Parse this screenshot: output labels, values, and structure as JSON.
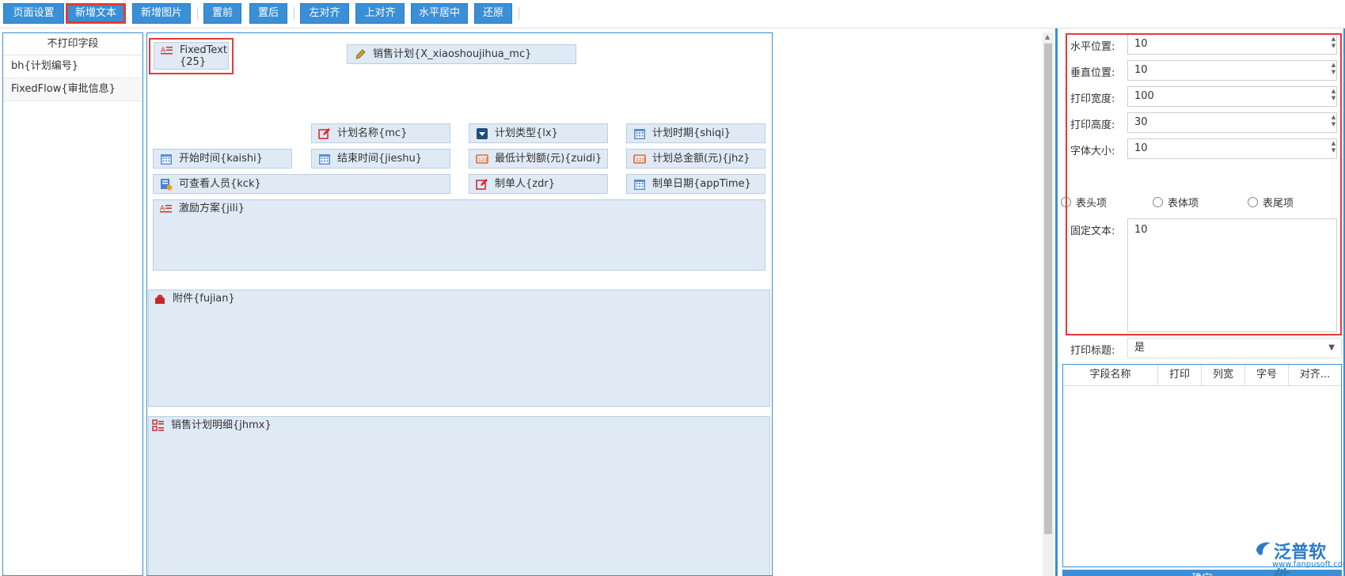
{
  "toolbar": {
    "buttons": [
      "页面设置",
      "新增文本",
      "新增图片",
      "置前",
      "置后",
      "左对齐",
      "上对齐",
      "水平居中",
      "还原"
    ]
  },
  "left_panel": {
    "title": "不打印字段",
    "items": [
      "bh{计划编号}",
      "FixedFlow{审批信息}"
    ]
  },
  "canvas": {
    "fixed_text": "FixedText{25}",
    "fields": {
      "title": "销售计划{X_xiaoshoujihua_mc}",
      "mc": "计划名称{mc}",
      "lx": "计划类型{lx}",
      "shiqi": "计划时期{shiqi}",
      "kaishi": "开始时间{kaishi}",
      "jieshu": "结束时间{jieshu}",
      "zuidi": "最低计划额(元){zuidi}",
      "jhz": "计划总金额(元){jhz}",
      "kck": "可查看人员{kck}",
      "zdr": "制单人{zdr}",
      "appTime": "制单日期{appTime}",
      "jili": "激励方案{jili}",
      "fujian": "附件{fujian}",
      "jhmx": "销售计划明细{jhmx}"
    }
  },
  "properties": {
    "h_pos_label": "水平位置:",
    "h_pos_value": "10",
    "v_pos_label": "垂直位置:",
    "v_pos_value": "10",
    "width_label": "打印宽度:",
    "width_value": "100",
    "height_label": "打印高度:",
    "height_value": "30",
    "font_label": "字体大小:",
    "font_value": "10",
    "radio_header": "表头项",
    "radio_body": "表体项",
    "radio_footer": "表尾项",
    "fixed_label": "固定文本:",
    "fixed_value": "10",
    "print_title_label": "打印标题:",
    "print_title_value": "是"
  },
  "grid": {
    "columns": [
      "字段名称",
      "打印",
      "列宽",
      "字号",
      "对齐..."
    ]
  },
  "confirm_label": "确定",
  "logo": {
    "name": "泛普软件",
    "url": "www.fanpusoft.com"
  },
  "colors": {
    "accent": "#3a8fd6",
    "highlight": "#e53935",
    "field_bg": "#dfeaf5"
  }
}
